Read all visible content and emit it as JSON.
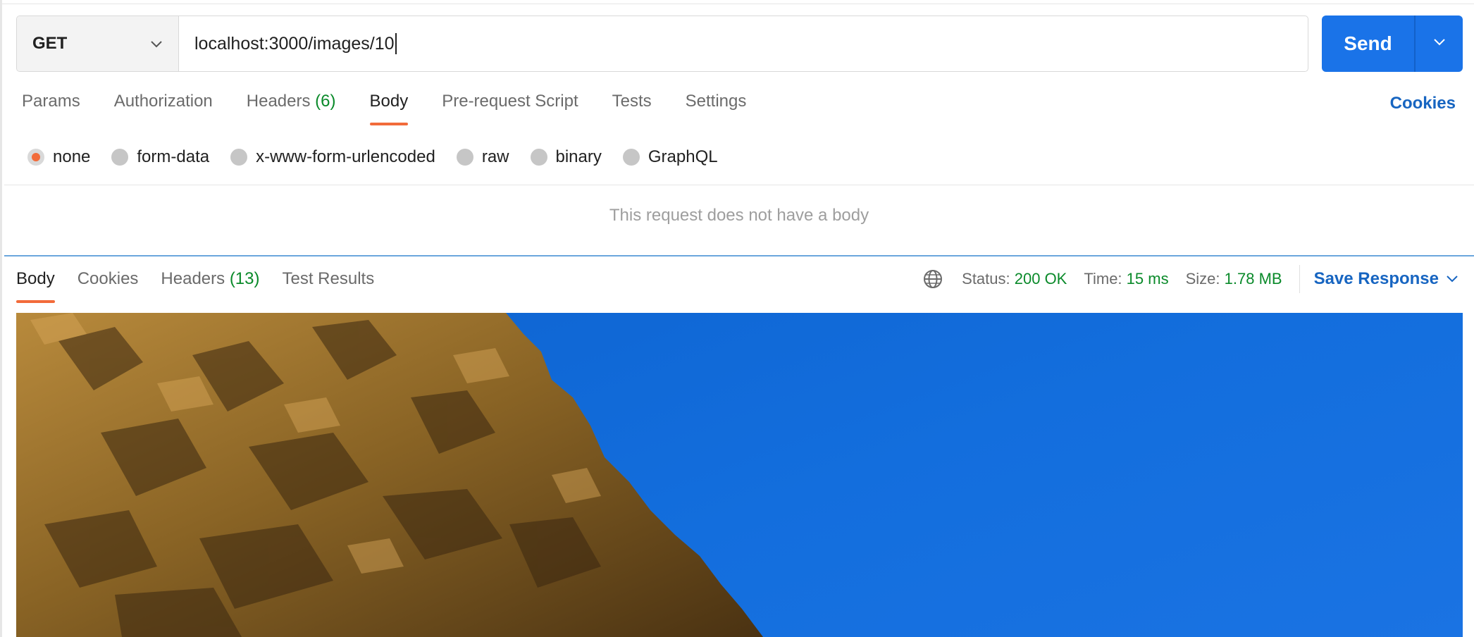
{
  "request": {
    "method": "GET",
    "url": "localhost:3000/images/10",
    "send_label": "Send"
  },
  "request_tabs": {
    "params": "Params",
    "authorization": "Authorization",
    "headers": "Headers",
    "headers_count": "(6)",
    "body": "Body",
    "pre_request": "Pre-request Script",
    "tests": "Tests",
    "settings": "Settings",
    "active": "Body"
  },
  "cookies_link": "Cookies",
  "body_types": {
    "none": "none",
    "form_data": "form-data",
    "urlencoded": "x-www-form-urlencoded",
    "raw": "raw",
    "binary": "binary",
    "graphql": "GraphQL",
    "selected": "none"
  },
  "no_body_message": "This request does not have a body",
  "response_tabs": {
    "body": "Body",
    "cookies": "Cookies",
    "headers": "Headers",
    "headers_count": "(13)",
    "test_results": "Test Results",
    "active": "Body"
  },
  "response_meta": {
    "status_label": "Status:",
    "status_value": "200 OK",
    "time_label": "Time:",
    "time_value": "15 ms",
    "size_label": "Size:",
    "size_value": "1.78 MB",
    "save_label": "Save Response"
  },
  "colors": {
    "accent_orange": "#f26b3a",
    "send_blue": "#1a73e8",
    "link_blue": "#1765c1",
    "success_green": "#0a8a2a",
    "sky_blue": "#136edd",
    "rock_brown": "#8a6425"
  },
  "icons": {
    "method_chevron": "chevron-down-icon",
    "send_dropdown": "chevron-down-icon",
    "network": "globe-icon",
    "save_chevron": "chevron-down-icon"
  }
}
